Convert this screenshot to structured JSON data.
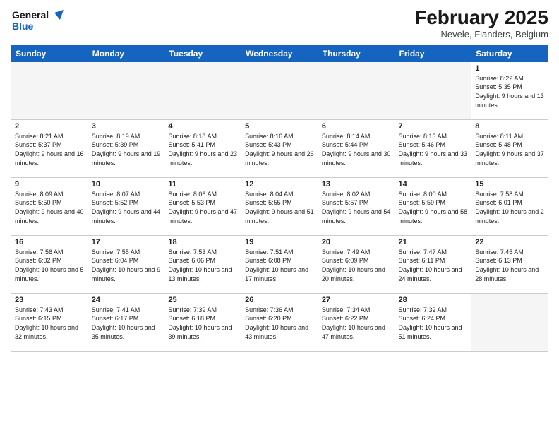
{
  "header": {
    "logo_general": "General",
    "logo_blue": "Blue",
    "month_title": "February 2025",
    "location": "Nevele, Flanders, Belgium"
  },
  "weekdays": [
    "Sunday",
    "Monday",
    "Tuesday",
    "Wednesday",
    "Thursday",
    "Friday",
    "Saturday"
  ],
  "weeks": [
    [
      {
        "day": "",
        "info": ""
      },
      {
        "day": "",
        "info": ""
      },
      {
        "day": "",
        "info": ""
      },
      {
        "day": "",
        "info": ""
      },
      {
        "day": "",
        "info": ""
      },
      {
        "day": "",
        "info": ""
      },
      {
        "day": "1",
        "info": "Sunrise: 8:22 AM\nSunset: 5:35 PM\nDaylight: 9 hours and 13 minutes."
      }
    ],
    [
      {
        "day": "2",
        "info": "Sunrise: 8:21 AM\nSunset: 5:37 PM\nDaylight: 9 hours and 16 minutes."
      },
      {
        "day": "3",
        "info": "Sunrise: 8:19 AM\nSunset: 5:39 PM\nDaylight: 9 hours and 19 minutes."
      },
      {
        "day": "4",
        "info": "Sunrise: 8:18 AM\nSunset: 5:41 PM\nDaylight: 9 hours and 23 minutes."
      },
      {
        "day": "5",
        "info": "Sunrise: 8:16 AM\nSunset: 5:43 PM\nDaylight: 9 hours and 26 minutes."
      },
      {
        "day": "6",
        "info": "Sunrise: 8:14 AM\nSunset: 5:44 PM\nDaylight: 9 hours and 30 minutes."
      },
      {
        "day": "7",
        "info": "Sunrise: 8:13 AM\nSunset: 5:46 PM\nDaylight: 9 hours and 33 minutes."
      },
      {
        "day": "8",
        "info": "Sunrise: 8:11 AM\nSunset: 5:48 PM\nDaylight: 9 hours and 37 minutes."
      }
    ],
    [
      {
        "day": "9",
        "info": "Sunrise: 8:09 AM\nSunset: 5:50 PM\nDaylight: 9 hours and 40 minutes."
      },
      {
        "day": "10",
        "info": "Sunrise: 8:07 AM\nSunset: 5:52 PM\nDaylight: 9 hours and 44 minutes."
      },
      {
        "day": "11",
        "info": "Sunrise: 8:06 AM\nSunset: 5:53 PM\nDaylight: 9 hours and 47 minutes."
      },
      {
        "day": "12",
        "info": "Sunrise: 8:04 AM\nSunset: 5:55 PM\nDaylight: 9 hours and 51 minutes."
      },
      {
        "day": "13",
        "info": "Sunrise: 8:02 AM\nSunset: 5:57 PM\nDaylight: 9 hours and 54 minutes."
      },
      {
        "day": "14",
        "info": "Sunrise: 8:00 AM\nSunset: 5:59 PM\nDaylight: 9 hours and 58 minutes."
      },
      {
        "day": "15",
        "info": "Sunrise: 7:58 AM\nSunset: 6:01 PM\nDaylight: 10 hours and 2 minutes."
      }
    ],
    [
      {
        "day": "16",
        "info": "Sunrise: 7:56 AM\nSunset: 6:02 PM\nDaylight: 10 hours and 5 minutes."
      },
      {
        "day": "17",
        "info": "Sunrise: 7:55 AM\nSunset: 6:04 PM\nDaylight: 10 hours and 9 minutes."
      },
      {
        "day": "18",
        "info": "Sunrise: 7:53 AM\nSunset: 6:06 PM\nDaylight: 10 hours and 13 minutes."
      },
      {
        "day": "19",
        "info": "Sunrise: 7:51 AM\nSunset: 6:08 PM\nDaylight: 10 hours and 17 minutes."
      },
      {
        "day": "20",
        "info": "Sunrise: 7:49 AM\nSunset: 6:09 PM\nDaylight: 10 hours and 20 minutes."
      },
      {
        "day": "21",
        "info": "Sunrise: 7:47 AM\nSunset: 6:11 PM\nDaylight: 10 hours and 24 minutes."
      },
      {
        "day": "22",
        "info": "Sunrise: 7:45 AM\nSunset: 6:13 PM\nDaylight: 10 hours and 28 minutes."
      }
    ],
    [
      {
        "day": "23",
        "info": "Sunrise: 7:43 AM\nSunset: 6:15 PM\nDaylight: 10 hours and 32 minutes."
      },
      {
        "day": "24",
        "info": "Sunrise: 7:41 AM\nSunset: 6:17 PM\nDaylight: 10 hours and 35 minutes."
      },
      {
        "day": "25",
        "info": "Sunrise: 7:39 AM\nSunset: 6:18 PM\nDaylight: 10 hours and 39 minutes."
      },
      {
        "day": "26",
        "info": "Sunrise: 7:36 AM\nSunset: 6:20 PM\nDaylight: 10 hours and 43 minutes."
      },
      {
        "day": "27",
        "info": "Sunrise: 7:34 AM\nSunset: 6:22 PM\nDaylight: 10 hours and 47 minutes."
      },
      {
        "day": "28",
        "info": "Sunrise: 7:32 AM\nSunset: 6:24 PM\nDaylight: 10 hours and 51 minutes."
      },
      {
        "day": "",
        "info": ""
      }
    ]
  ]
}
